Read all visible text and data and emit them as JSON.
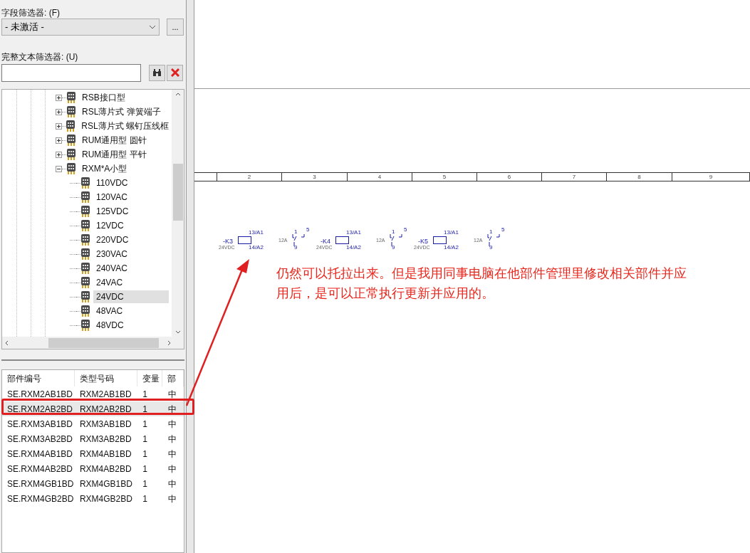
{
  "field_filter": {
    "label": "字段筛选器: (F)",
    "value": "- 未激活 -",
    "more_button": "..."
  },
  "text_filter": {
    "label": "完整文本筛选器: (U)"
  },
  "tree": [
    {
      "label": "RSB接口型",
      "expanded": false,
      "selected": false
    },
    {
      "label": "RSL薄片式 弹簧端子",
      "expanded": false,
      "selected": false
    },
    {
      "label": "RSL薄片式 螺钉压线框",
      "expanded": false,
      "selected": false
    },
    {
      "label": "RUM通用型 圆针",
      "expanded": false,
      "selected": false
    },
    {
      "label": "RUM通用型 平针",
      "expanded": false,
      "selected": false
    },
    {
      "label": "RXM*A小型",
      "expanded": true,
      "selected": false,
      "children": [
        {
          "label": "110VDC",
          "selected": false
        },
        {
          "label": "120VAC",
          "selected": false
        },
        {
          "label": "125VDC",
          "selected": false
        },
        {
          "label": "12VDC",
          "selected": false
        },
        {
          "label": "220VDC",
          "selected": false
        },
        {
          "label": "230VAC",
          "selected": false
        },
        {
          "label": "240VAC",
          "selected": false
        },
        {
          "label": "24VAC",
          "selected": false
        },
        {
          "label": "24VDC",
          "selected": true
        },
        {
          "label": "48VAC",
          "selected": false
        },
        {
          "label": "48VDC",
          "selected": false
        }
      ]
    }
  ],
  "table": {
    "columns": [
      "部件编号",
      "类型号码",
      "变量",
      "部"
    ],
    "rows": [
      {
        "cells": [
          "SE.RXM2AB1BD",
          "RXM2AB1BD",
          "1",
          "中"
        ],
        "selected": false
      },
      {
        "cells": [
          "SE.RXM2AB2BD",
          "RXM2AB2BD",
          "1",
          "中"
        ],
        "selected": true
      },
      {
        "cells": [
          "SE.RXM3AB1BD",
          "RXM3AB1BD",
          "1",
          "中"
        ],
        "selected": false
      },
      {
        "cells": [
          "SE.RXM3AB2BD",
          "RXM3AB2BD",
          "1",
          "中"
        ],
        "selected": false
      },
      {
        "cells": [
          "SE.RXM4AB1BD",
          "RXM4AB1BD",
          "1",
          "中"
        ],
        "selected": false
      },
      {
        "cells": [
          "SE.RXM4AB2BD",
          "RXM4AB2BD",
          "1",
          "中"
        ],
        "selected": false
      },
      {
        "cells": [
          "SE.RXM4GB1BD",
          "RXM4GB1BD",
          "1",
          "中"
        ],
        "selected": false
      },
      {
        "cells": [
          "SE.RXM4GB2BD",
          "RXM4GB2BD",
          "1",
          "中"
        ],
        "selected": false
      }
    ]
  },
  "canvas": {
    "columns": [
      "",
      "2",
      "3",
      "4",
      "5",
      "6",
      "7",
      "8",
      "9"
    ],
    "symbols": [
      {
        "tag": "-K3",
        "rating": "24VDC",
        "top": "13/A1",
        "bottom": "14/A2",
        "current": "12A",
        "c1": "1",
        "c2": "5",
        "c3": "9"
      },
      {
        "tag": "-K4",
        "rating": "24VDC",
        "top": "13/A1",
        "bottom": "14/A2",
        "current": "12A",
        "c1": "1",
        "c2": "5",
        "c3": "9"
      },
      {
        "tag": "-K5",
        "rating": "24VDC",
        "top": "13/A1",
        "bottom": "14/A2",
        "current": "12A",
        "c1": "1",
        "c2": "5",
        "c3": "9"
      }
    ],
    "annotation": "仍然可以托拉出来。但是我用同事电脑在他部件管理里修改相关部件并应用后，是可以正常执行更新并应用的。"
  }
}
